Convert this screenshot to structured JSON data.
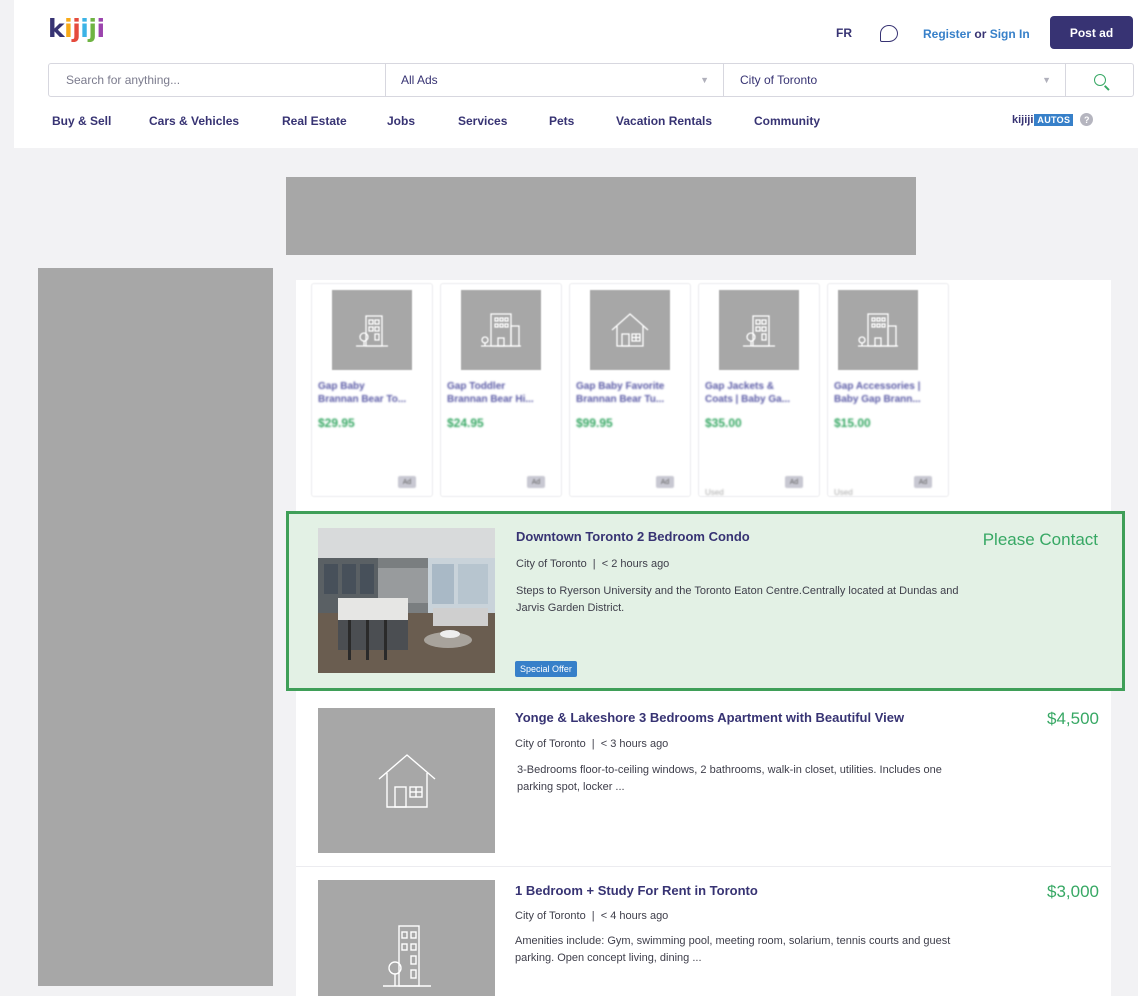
{
  "header": {
    "logo": {
      "k": "k",
      "i1": "i",
      "j1": "j",
      "i2": "i",
      "j2": "j",
      "i3": "i"
    },
    "lang": "FR",
    "register": "Register",
    "or": "or",
    "sign_in": "Sign In",
    "post_ad": "Post ad",
    "chat_icon": "chat-bubble-icon"
  },
  "search": {
    "placeholder": "Search for anything...",
    "category": "All Ads",
    "location": "City of Toronto"
  },
  "nav": {
    "items": [
      "Buy & Sell",
      "Cars & Vehicles",
      "Real Estate",
      "Jobs",
      "Services",
      "Pets",
      "Vacation Rentals",
      "Community"
    ],
    "autos_brand": "kijiji",
    "autos_badge": "AUTOS",
    "help": "?"
  },
  "promoted": [
    {
      "title": "Gap Baby\nBrannan Bear To...",
      "price": "$29.95",
      "used": "",
      "icon": "apartment-building-icon"
    },
    {
      "title": "Gap Toddler\nBrannan Bear Hi...",
      "price": "$24.95",
      "used": "",
      "icon": "office-building-icon"
    },
    {
      "title": "Gap Baby Favorite\nBrannan Bear Tu...",
      "price": "$99.95",
      "used": "",
      "icon": "house-icon"
    },
    {
      "title": "Gap Jackets &\nCoats | Baby Ga...",
      "price": "$35.00",
      "used": "Used",
      "icon": "apartment-building-icon"
    },
    {
      "title": "Gap Accessories |\nBaby Gap Brann...",
      "price": "$15.00",
      "used": "Used",
      "icon": "office-building-icon"
    }
  ],
  "listings": [
    {
      "title": "Downtown Toronto 2 Bedroom Condo",
      "location": "City of Toronto",
      "time": "< 2 hours ago",
      "desc": "Steps to Ryerson University and the Toronto Eaton Centre.Centrally located at Dundas and Jarvis Garden District.",
      "price": "Please Contact",
      "tag": "Special Offer"
    },
    {
      "title": "Yonge & Lakeshore 3 Bedrooms Apartment with Beautiful View",
      "location": "City of Toronto",
      "time": "< 3 hours ago",
      "desc": "3-Bedrooms floor-to-ceiling windows, 2 bathrooms, walk-in closet, utilities. Includes one parking spot, locker ...",
      "price": "$4,500"
    },
    {
      "title": "1 Bedroom + Study For Rent in Toronto",
      "location": "City of Toronto",
      "time": "< 4 hours ago",
      "desc": "Amenities include: Gym, swimming pool, meeting room, solarium, tennis courts and guest parking. Open concept living, dining ...",
      "price": "$3,000"
    }
  ],
  "meta_sep": "|",
  "colors": {
    "brand": "#373373",
    "link": "#3780c9",
    "price": "#37a864",
    "featured_bg": "#e3f1e5",
    "featured_border": "#3f9f58",
    "placeholder": "#a7a7a7"
  }
}
